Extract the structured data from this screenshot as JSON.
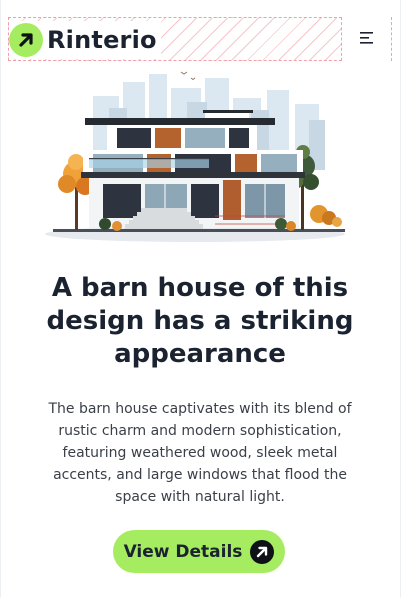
{
  "header": {
    "brand_name": "Rinterio",
    "brand_icon": "arrow-up-right-icon",
    "menu_icon": "hamburger-menu-icon"
  },
  "hero": {
    "illustration": "modern-house-illustration",
    "headline": "A barn house of this design has a striking appearance",
    "description": "The barn house captivates with its blend of rustic charm and modern sophistication, featuring weathered wood, sleek metal accents, and large windows that flood the space with natural light.",
    "cta_label": "View Details",
    "cta_icon": "arrow-up-right-icon"
  },
  "colors": {
    "accent": "#a6ec61",
    "text": "#1b2230",
    "body_text": "#3a3f48",
    "dark_icon_bg": "#0e1116",
    "debug_outline": "#f2a0a8"
  }
}
